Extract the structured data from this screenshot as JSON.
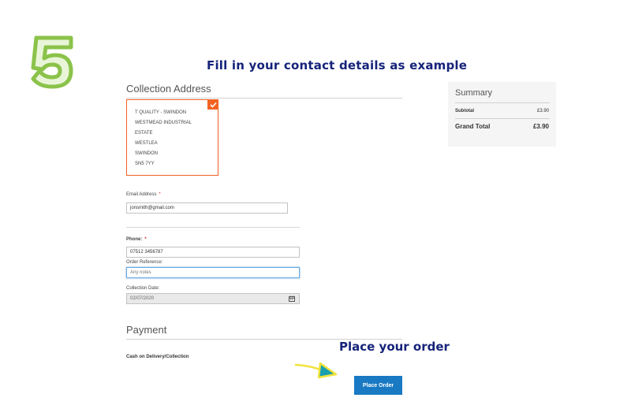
{
  "overlay": {
    "step_number": "5",
    "instruction": "Fill in your contact details as example",
    "callout": "Place your order",
    "step_color": "#8bc34a",
    "text_color": "#16237a",
    "arrow_color": "#f0e33a"
  },
  "collection_address": {
    "title": "Collection Address",
    "lines": [
      "T QUALITY - SWINDON",
      "WESTMEAD INDUSTRIAL",
      "ESTATE",
      "WESTLEA",
      "SWINDON",
      "SN5 7YY"
    ],
    "selected": true,
    "accent": "#f26322"
  },
  "form": {
    "email": {
      "label": "Email Address",
      "required": "*",
      "value": "jonsmith@gmail.com"
    },
    "phone": {
      "label": "Phone:",
      "required": "*",
      "value": "07512 3456787"
    },
    "order_reference": {
      "label": "Order Reference:",
      "placeholder": "Any notes"
    },
    "collection_date": {
      "label": "Collection Date:",
      "value": "02/07/2020",
      "icon": "calendar-icon"
    }
  },
  "payment": {
    "title": "Payment",
    "method": "Cash on Delivery/Collection"
  },
  "place_order": {
    "label": "Place Order",
    "color": "#1979c3"
  },
  "summary": {
    "title": "Summary",
    "subtotal_label": "Subtotal",
    "subtotal_value": "£3.90",
    "grand_total_label": "Grand Total",
    "grand_total_value": "£3.90"
  }
}
